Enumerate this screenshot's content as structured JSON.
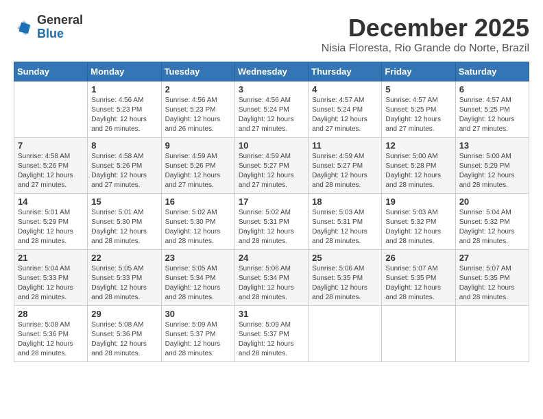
{
  "header": {
    "logo": {
      "general": "General",
      "blue": "Blue"
    },
    "title": "December 2025",
    "location": "Nisia Floresta, Rio Grande do Norte, Brazil"
  },
  "calendar": {
    "days_of_week": [
      "Sunday",
      "Monday",
      "Tuesday",
      "Wednesday",
      "Thursday",
      "Friday",
      "Saturday"
    ],
    "weeks": [
      [
        {
          "day": "",
          "info": ""
        },
        {
          "day": "1",
          "info": "Sunrise: 4:56 AM\nSunset: 5:23 PM\nDaylight: 12 hours\nand 26 minutes."
        },
        {
          "day": "2",
          "info": "Sunrise: 4:56 AM\nSunset: 5:23 PM\nDaylight: 12 hours\nand 26 minutes."
        },
        {
          "day": "3",
          "info": "Sunrise: 4:56 AM\nSunset: 5:24 PM\nDaylight: 12 hours\nand 27 minutes."
        },
        {
          "day": "4",
          "info": "Sunrise: 4:57 AM\nSunset: 5:24 PM\nDaylight: 12 hours\nand 27 minutes."
        },
        {
          "day": "5",
          "info": "Sunrise: 4:57 AM\nSunset: 5:25 PM\nDaylight: 12 hours\nand 27 minutes."
        },
        {
          "day": "6",
          "info": "Sunrise: 4:57 AM\nSunset: 5:25 PM\nDaylight: 12 hours\nand 27 minutes."
        }
      ],
      [
        {
          "day": "7",
          "info": "Sunrise: 4:58 AM\nSunset: 5:26 PM\nDaylight: 12 hours\nand 27 minutes."
        },
        {
          "day": "8",
          "info": "Sunrise: 4:58 AM\nSunset: 5:26 PM\nDaylight: 12 hours\nand 27 minutes."
        },
        {
          "day": "9",
          "info": "Sunrise: 4:59 AM\nSunset: 5:26 PM\nDaylight: 12 hours\nand 27 minutes."
        },
        {
          "day": "10",
          "info": "Sunrise: 4:59 AM\nSunset: 5:27 PM\nDaylight: 12 hours\nand 27 minutes."
        },
        {
          "day": "11",
          "info": "Sunrise: 4:59 AM\nSunset: 5:27 PM\nDaylight: 12 hours\nand 28 minutes."
        },
        {
          "day": "12",
          "info": "Sunrise: 5:00 AM\nSunset: 5:28 PM\nDaylight: 12 hours\nand 28 minutes."
        },
        {
          "day": "13",
          "info": "Sunrise: 5:00 AM\nSunset: 5:29 PM\nDaylight: 12 hours\nand 28 minutes."
        }
      ],
      [
        {
          "day": "14",
          "info": "Sunrise: 5:01 AM\nSunset: 5:29 PM\nDaylight: 12 hours\nand 28 minutes."
        },
        {
          "day": "15",
          "info": "Sunrise: 5:01 AM\nSunset: 5:30 PM\nDaylight: 12 hours\nand 28 minutes."
        },
        {
          "day": "16",
          "info": "Sunrise: 5:02 AM\nSunset: 5:30 PM\nDaylight: 12 hours\nand 28 minutes."
        },
        {
          "day": "17",
          "info": "Sunrise: 5:02 AM\nSunset: 5:31 PM\nDaylight: 12 hours\nand 28 minutes."
        },
        {
          "day": "18",
          "info": "Sunrise: 5:03 AM\nSunset: 5:31 PM\nDaylight: 12 hours\nand 28 minutes."
        },
        {
          "day": "19",
          "info": "Sunrise: 5:03 AM\nSunset: 5:32 PM\nDaylight: 12 hours\nand 28 minutes."
        },
        {
          "day": "20",
          "info": "Sunrise: 5:04 AM\nSunset: 5:32 PM\nDaylight: 12 hours\nand 28 minutes."
        }
      ],
      [
        {
          "day": "21",
          "info": "Sunrise: 5:04 AM\nSunset: 5:33 PM\nDaylight: 12 hours\nand 28 minutes."
        },
        {
          "day": "22",
          "info": "Sunrise: 5:05 AM\nSunset: 5:33 PM\nDaylight: 12 hours\nand 28 minutes."
        },
        {
          "day": "23",
          "info": "Sunrise: 5:05 AM\nSunset: 5:34 PM\nDaylight: 12 hours\nand 28 minutes."
        },
        {
          "day": "24",
          "info": "Sunrise: 5:06 AM\nSunset: 5:34 PM\nDaylight: 12 hours\nand 28 minutes."
        },
        {
          "day": "25",
          "info": "Sunrise: 5:06 AM\nSunset: 5:35 PM\nDaylight: 12 hours\nand 28 minutes."
        },
        {
          "day": "26",
          "info": "Sunrise: 5:07 AM\nSunset: 5:35 PM\nDaylight: 12 hours\nand 28 minutes."
        },
        {
          "day": "27",
          "info": "Sunrise: 5:07 AM\nSunset: 5:35 PM\nDaylight: 12 hours\nand 28 minutes."
        }
      ],
      [
        {
          "day": "28",
          "info": "Sunrise: 5:08 AM\nSunset: 5:36 PM\nDaylight: 12 hours\nand 28 minutes."
        },
        {
          "day": "29",
          "info": "Sunrise: 5:08 AM\nSunset: 5:36 PM\nDaylight: 12 hours\nand 28 minutes."
        },
        {
          "day": "30",
          "info": "Sunrise: 5:09 AM\nSunset: 5:37 PM\nDaylight: 12 hours\nand 28 minutes."
        },
        {
          "day": "31",
          "info": "Sunrise: 5:09 AM\nSunset: 5:37 PM\nDaylight: 12 hours\nand 28 minutes."
        },
        {
          "day": "",
          "info": ""
        },
        {
          "day": "",
          "info": ""
        },
        {
          "day": "",
          "info": ""
        }
      ]
    ]
  }
}
